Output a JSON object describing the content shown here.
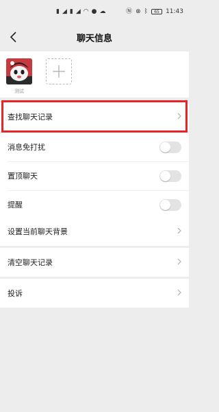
{
  "status_bar": {
    "time": "11:43",
    "battery": "65",
    "left_icons": [
      "sim-hd-icon",
      "signal-icon",
      "sim-hd-icon",
      "signal-icon",
      "wifi-icon",
      "wechat-icon",
      "cloud-icon"
    ],
    "right_icons": [
      "nfc-icon",
      "mute-icon",
      "bluetooth-icon",
      "battery-icon"
    ]
  },
  "header": {
    "title": "聊天信息",
    "back_icon": "chevron-left-icon"
  },
  "members": [
    {
      "name": "测试",
      "avatar": "cartoon-avatar"
    }
  ],
  "add_member_icon": "plus-icon",
  "search_section": {
    "label": "查找聊天记录",
    "highlight_color": "#e5252a"
  },
  "toggles": [
    {
      "label": "消息免打扰",
      "on": false
    },
    {
      "label": "置顶聊天",
      "on": false
    },
    {
      "label": "提醒",
      "on": false
    }
  ],
  "background_section": {
    "label": "设置当前聊天背景"
  },
  "clear_section": {
    "label": "清空聊天记录"
  },
  "report_section": {
    "label": "投诉"
  },
  "colors": {
    "page_bg": "#ededed",
    "card_bg": "#ffffff",
    "toggle_off": "#e3e3e3"
  }
}
